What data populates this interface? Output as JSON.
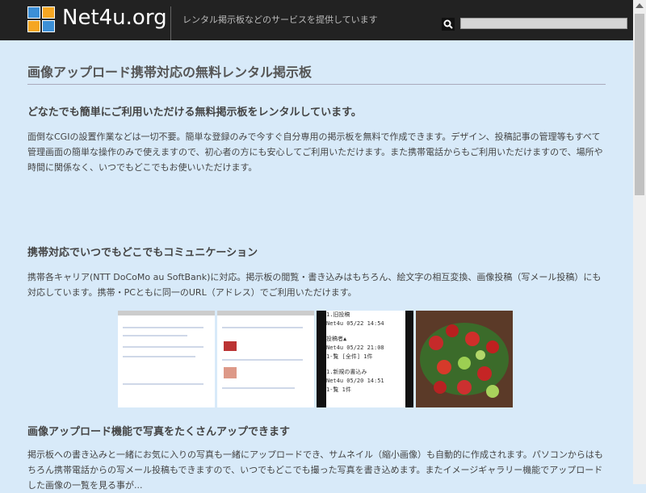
{
  "header": {
    "site_name": "Net4u.org",
    "tagline": "レンタル掲示板などのサービスを提供しています",
    "search_placeholder": ""
  },
  "main": {
    "title": "画像アップロード携帯対応の無料レンタル掲示板",
    "sections": [
      {
        "heading": "どなたでも簡単にご利用いただける無料掲示板をレンタルしています。",
        "paragraph": "面倒なCGIの設置作業などは一切不要。簡単な登録のみで今すぐ自分専用の掲示板を無料で作成できます。デザイン、投稿記事の管理等もすべて管理画面の簡単な操作のみで使えますので、初心者の方にも安心してご利用いただけます。また携帯電話からもご利用いただけますので、場所や時間に関係なく、いつでもどこでもお使いいただけます。"
      },
      {
        "heading": "携帯対応でいつでもどこでもコミュニケーション",
        "paragraph": "携帯各キャリア(NTT DoCoMo au SoftBank)に対応。掲示板の閲覧・書き込みはもちろん、絵文字の相互変換、画像投稿（写メール投稿）にも対応しています。携帯・PCともに同一のURL（アドレス）でご利用いただけます。"
      },
      {
        "heading": "画像アップロード機能で写真をたくさんアップできます",
        "paragraph": "掲示板への書き込みと一緒にお気に入りの写真も一緒にアップロードでき、サムネイル（縮小画像）も自動的に作成されます。パソコンからはもちろん携帯電話からの写メール投稿もできますので、いつでもどこでも撮った写真を書き込めます。またイメージギャラリー機能でアップロードした画像の一覧を見る事が..."
      }
    ],
    "phone_screen": {
      "lines": [
        "1.旧投稿",
        "Net4u 05/22 14:54",
        "投稿者▲",
        "Net4u 05/22 21:08",
        "1-覧 [全件] 1件",
        "1.新規の書込み",
        "Net4u 05/20 14:51",
        "1-覧 1件"
      ]
    }
  },
  "colors": {
    "header_bg": "#222222",
    "page_bg": "#d8eaf9",
    "logo_tiles": [
      "#3c8fd6",
      "#f5a623",
      "#f5a623",
      "#3c8fd6"
    ]
  }
}
